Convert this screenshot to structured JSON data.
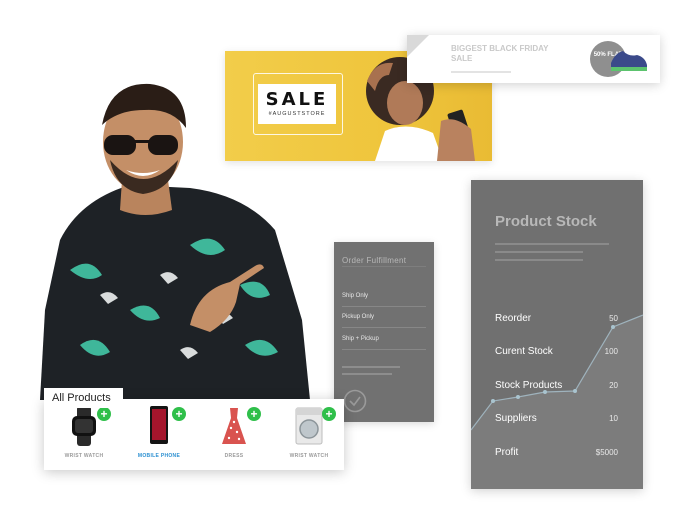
{
  "sale_banner": {
    "title": "SALE",
    "subtitle": "#AUGUSTSTORE"
  },
  "friday_banner": {
    "title": "BIGGEST BLACK FRIDAY SALE",
    "badge": "50% FLAT"
  },
  "order_card": {
    "title": "Order Fulfillment",
    "rows": [
      "Ship Only",
      "Pickup Only",
      "Ship + Pickup"
    ]
  },
  "stock_card": {
    "title": "Product Stock",
    "rows": [
      {
        "label": "Reorder",
        "value": "50"
      },
      {
        "label": "Curent Stock",
        "value": "100"
      },
      {
        "label": "Stock Products",
        "value": "20"
      },
      {
        "label": "Suppliers",
        "value": "10"
      },
      {
        "label": "Profit",
        "value": "$5000"
      }
    ]
  },
  "products": {
    "tab_label": "All Products",
    "items": [
      {
        "caption": "WRIST WATCH",
        "icon": "watch-icon",
        "active": false
      },
      {
        "caption": "MOBILE PHONE",
        "icon": "phone-icon",
        "active": true
      },
      {
        "caption": "DRESS",
        "icon": "dress-icon",
        "active": false
      },
      {
        "caption": "WRIST WATCH",
        "icon": "washing-machine-icon",
        "active": false
      }
    ]
  },
  "colors": {
    "accent_green": "#2fbf4a",
    "banner_yellow": "#f2cd4a",
    "card_gray": "#707070",
    "active_blue": "#2a8fd1"
  }
}
